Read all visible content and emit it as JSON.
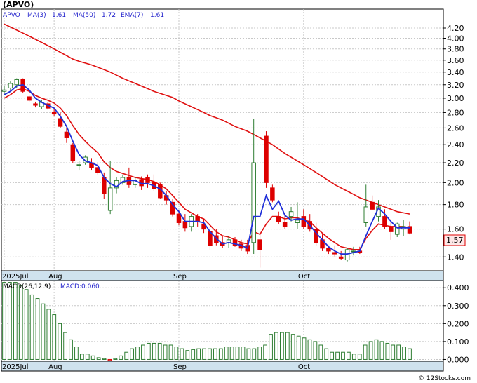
{
  "ticker_label": "(APVO)",
  "legend": {
    "symbol": "APVO",
    "ma3_label": "MA(3)",
    "ma3_value": "1.61",
    "ma50_label": "MA(50)",
    "ma50_value": "1.72",
    "ema7_label": "EMA(7)",
    "ema7_value": "1.61"
  },
  "last_price_badge": "1.57",
  "macd_legend": {
    "label": "MACD(26,12,9)",
    "value_label": "MACD:0.060"
  },
  "watermark": "© 12Stocks.com",
  "colors": {
    "up_candle": "#2e7d32",
    "down_candle": "#dd0000",
    "ma3": "#1f2fd8",
    "ma50": "#e01010",
    "ema7": "#e01010",
    "macd": "#2e7d32",
    "badge_fill": "#fde7e7",
    "badge_border": "#dd0000",
    "axis_strip": "#cfe2ee"
  },
  "chart_data": [
    {
      "type": "candlestick",
      "title": "(APVO)",
      "yaxis_ticks": [
        "4.20",
        "4.00",
        "3.80",
        "3.60",
        "3.40",
        "3.20",
        "3.00",
        "2.80",
        "2.60",
        "2.40",
        "2.20",
        "2.00",
        "1.80",
        "1.60",
        "1.40"
      ],
      "ylim": [
        1.31,
        4.6
      ],
      "y_scale": "log",
      "x_labels": [
        {
          "text": "2025Jul",
          "index": 0
        },
        {
          "text": "Aug",
          "index": 8
        },
        {
          "text": "Sep",
          "index": 28
        },
        {
          "text": "Oct",
          "index": 48
        }
      ],
      "ohlc": [
        [
          3.1,
          3.18,
          3.05,
          3.12
        ],
        [
          3.15,
          3.25,
          3.1,
          3.22
        ],
        [
          3.2,
          3.3,
          3.15,
          3.28
        ],
        [
          3.28,
          3.3,
          3.08,
          3.1
        ],
        [
          3.02,
          3.05,
          2.95,
          2.97
        ],
        [
          2.92,
          2.95,
          2.87,
          2.9
        ],
        [
          2.88,
          2.98,
          2.85,
          2.94
        ],
        [
          2.92,
          2.95,
          2.84,
          2.86
        ],
        [
          2.8,
          2.85,
          2.75,
          2.78
        ],
        [
          2.72,
          2.8,
          2.6,
          2.62
        ],
        [
          2.55,
          2.6,
          2.42,
          2.48
        ],
        [
          2.4,
          2.42,
          2.2,
          2.22
        ],
        [
          2.18,
          2.22,
          2.12,
          2.18
        ],
        [
          2.2,
          2.28,
          2.18,
          2.26
        ],
        [
          2.2,
          2.25,
          2.12,
          2.15
        ],
        [
          2.15,
          2.2,
          2.08,
          2.1
        ],
        [
          2.05,
          2.1,
          1.85,
          1.9
        ],
        [
          1.75,
          2.22,
          1.72,
          1.95
        ],
        [
          1.95,
          2.05,
          1.9,
          2.02
        ],
        [
          2.0,
          2.08,
          1.98,
          2.05
        ],
        [
          2.05,
          2.15,
          1.95,
          1.98
        ],
        [
          1.98,
          2.05,
          1.95,
          2.02
        ],
        [
          2.03,
          2.06,
          1.93,
          1.97
        ],
        [
          2.05,
          2.08,
          1.95,
          2.0
        ],
        [
          2.0,
          2.08,
          1.92,
          1.94
        ],
        [
          1.98,
          2.0,
          1.85,
          1.86
        ],
        [
          1.88,
          1.92,
          1.8,
          1.84
        ],
        [
          1.82,
          1.85,
          1.7,
          1.72
        ],
        [
          1.72,
          1.75,
          1.63,
          1.65
        ],
        [
          1.66,
          1.72,
          1.58,
          1.61
        ],
        [
          1.62,
          1.72,
          1.58,
          1.7
        ],
        [
          1.7,
          1.72,
          1.62,
          1.66
        ],
        [
          1.64,
          1.68,
          1.57,
          1.6
        ],
        [
          1.58,
          1.62,
          1.45,
          1.48
        ],
        [
          1.55,
          1.6,
          1.48,
          1.5
        ],
        [
          1.5,
          1.55,
          1.46,
          1.48
        ],
        [
          1.5,
          1.55,
          1.46,
          1.52
        ],
        [
          1.52,
          1.54,
          1.47,
          1.48
        ],
        [
          1.49,
          1.52,
          1.44,
          1.46
        ],
        [
          1.48,
          1.52,
          1.42,
          1.44
        ],
        [
          1.5,
          2.72,
          1.42,
          2.2
        ],
        [
          1.52,
          1.58,
          1.33,
          1.45
        ],
        [
          2.5,
          2.56,
          1.95,
          2.0
        ],
        [
          1.95,
          1.98,
          1.82,
          1.84
        ],
        [
          1.7,
          1.74,
          1.64,
          1.66
        ],
        [
          1.65,
          1.72,
          1.6,
          1.62
        ],
        [
          1.7,
          1.78,
          1.66,
          1.74
        ],
        [
          1.65,
          1.82,
          1.6,
          1.67
        ],
        [
          1.7,
          1.76,
          1.6,
          1.62
        ],
        [
          1.66,
          1.72,
          1.58,
          1.6
        ],
        [
          1.6,
          1.65,
          1.48,
          1.5
        ],
        [
          1.52,
          1.56,
          1.44,
          1.46
        ],
        [
          1.46,
          1.48,
          1.42,
          1.44
        ],
        [
          1.43,
          1.48,
          1.4,
          1.42
        ],
        [
          1.4,
          1.44,
          1.38,
          1.39
        ],
        [
          1.38,
          1.46,
          1.37,
          1.45
        ],
        [
          1.44,
          1.47,
          1.41,
          1.44
        ],
        [
          1.44,
          1.47,
          1.42,
          1.43
        ],
        [
          1.65,
          1.98,
          1.62,
          1.78
        ],
        [
          1.82,
          1.88,
          1.75,
          1.76
        ],
        [
          1.7,
          1.84,
          1.66,
          1.78
        ],
        [
          1.7,
          1.76,
          1.6,
          1.62
        ],
        [
          1.62,
          1.68,
          1.52,
          1.58
        ],
        [
          1.56,
          1.65,
          1.54,
          1.64
        ],
        [
          1.6,
          1.67,
          1.55,
          1.62
        ],
        [
          1.62,
          1.66,
          1.56,
          1.57
        ]
      ],
      "ma3": [
        3.05,
        3.1,
        3.18,
        3.2,
        3.12,
        3.0,
        2.94,
        2.9,
        2.86,
        2.75,
        2.62,
        2.44,
        2.29,
        2.22,
        2.2,
        2.17,
        2.05,
        1.99,
        1.96,
        2.01,
        2.02,
        2.02,
        1.99,
        1.99,
        1.97,
        1.94,
        1.88,
        1.8,
        1.74,
        1.66,
        1.66,
        1.66,
        1.65,
        1.58,
        1.53,
        1.49,
        1.5,
        1.49,
        1.48,
        1.46,
        1.7,
        1.7,
        1.88,
        1.76,
        1.83,
        1.71,
        1.67,
        1.68,
        1.68,
        1.63,
        1.57,
        1.52,
        1.47,
        1.44,
        1.42,
        1.42,
        1.43,
        1.44,
        1.55,
        1.66,
        1.77,
        1.72,
        1.66,
        1.61,
        1.61,
        1.61
      ],
      "ma50": [
        4.28,
        4.22,
        4.16,
        4.1,
        4.04,
        3.98,
        3.92,
        3.86,
        3.8,
        3.74,
        3.68,
        3.62,
        3.58,
        3.55,
        3.52,
        3.48,
        3.44,
        3.4,
        3.35,
        3.3,
        3.26,
        3.22,
        3.18,
        3.14,
        3.1,
        3.07,
        3.04,
        3.01,
        2.96,
        2.92,
        2.88,
        2.84,
        2.8,
        2.76,
        2.73,
        2.7,
        2.66,
        2.62,
        2.59,
        2.56,
        2.52,
        2.48,
        2.44,
        2.4,
        2.35,
        2.3,
        2.26,
        2.22,
        2.18,
        2.14,
        2.1,
        2.06,
        2.02,
        1.98,
        1.95,
        1.92,
        1.89,
        1.86,
        1.84,
        1.82,
        1.8,
        1.78,
        1.76,
        1.74,
        1.73,
        1.72
      ],
      "ema7": [
        3.0,
        3.05,
        3.12,
        3.14,
        3.1,
        3.04,
        3.0,
        2.97,
        2.93,
        2.86,
        2.76,
        2.63,
        2.52,
        2.44,
        2.37,
        2.31,
        2.21,
        2.15,
        2.11,
        2.09,
        2.07,
        2.05,
        2.04,
        2.03,
        2.01,
        1.98,
        1.94,
        1.88,
        1.82,
        1.76,
        1.73,
        1.7,
        1.68,
        1.63,
        1.58,
        1.55,
        1.54,
        1.52,
        1.5,
        1.49,
        1.58,
        1.56,
        1.64,
        1.7,
        1.7,
        1.68,
        1.69,
        1.69,
        1.67,
        1.66,
        1.61,
        1.57,
        1.53,
        1.5,
        1.47,
        1.46,
        1.45,
        1.45,
        1.53,
        1.59,
        1.64,
        1.63,
        1.62,
        1.62,
        1.62,
        1.61
      ]
    },
    {
      "type": "bar",
      "title": "MACD(26,12,9)",
      "yaxis_ticks": [
        "0.400",
        "0.300",
        "0.200",
        "0.100",
        "0.000"
      ],
      "ylim": [
        -0.01,
        0.44
      ],
      "x_labels": [
        {
          "text": "2025Jul",
          "index": 0
        },
        {
          "text": "Aug",
          "index": 8
        },
        {
          "text": "Sep",
          "index": 28
        },
        {
          "text": "Oct",
          "index": 48
        }
      ],
      "values": [
        0.43,
        0.43,
        0.43,
        0.41,
        0.39,
        0.36,
        0.34,
        0.31,
        0.28,
        0.25,
        0.2,
        0.15,
        0.11,
        0.07,
        0.03,
        0.03,
        0.02,
        0.01,
        0.005,
        -0.005,
        0.005,
        0.02,
        0.04,
        0.06,
        0.07,
        0.08,
        0.09,
        0.09,
        0.09,
        0.08,
        0.08,
        0.07,
        0.06,
        0.05,
        0.055,
        0.06,
        0.06,
        0.06,
        0.06,
        0.06,
        0.07,
        0.07,
        0.07,
        0.07,
        0.06,
        0.06,
        0.07,
        0.08,
        0.14,
        0.15,
        0.15,
        0.15,
        0.14,
        0.13,
        0.12,
        0.11,
        0.1,
        0.08,
        0.06,
        0.04,
        0.04,
        0.04,
        0.04,
        0.03,
        0.03,
        0.08,
        0.1,
        0.11,
        0.1,
        0.09,
        0.08,
        0.08,
        0.07,
        0.06
      ]
    }
  ]
}
